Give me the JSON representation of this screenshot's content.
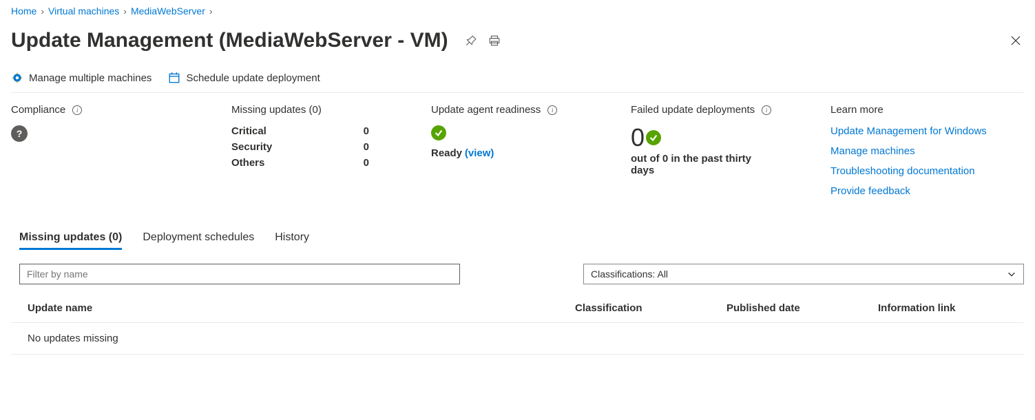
{
  "breadcrumb": {
    "items": [
      "Home",
      "Virtual machines",
      "MediaWebServer"
    ]
  },
  "page_title": "Update Management (MediaWebServer - VM)",
  "toolbar": {
    "manage_multiple": "Manage multiple machines",
    "schedule_deployment": "Schedule update deployment"
  },
  "stats": {
    "compliance_label": "Compliance",
    "missing_updates_label": "Missing updates (0)",
    "missing_rows": [
      {
        "label": "Critical",
        "value": "0"
      },
      {
        "label": "Security",
        "value": "0"
      },
      {
        "label": "Others",
        "value": "0"
      }
    ],
    "readiness_label": "Update agent readiness",
    "readiness_status": "Ready",
    "readiness_view": "(view)",
    "failed_label": "Failed update deployments",
    "failed_count": "0",
    "failed_sub": "out of 0 in the past thirty days",
    "learn_more_label": "Learn more",
    "learn_links": [
      "Update Management for Windows",
      "Manage machines",
      "Troubleshooting documentation",
      "Provide feedback"
    ]
  },
  "tabs": [
    {
      "label": "Missing updates (0)",
      "active": true
    },
    {
      "label": "Deployment schedules",
      "active": false
    },
    {
      "label": "History",
      "active": false
    }
  ],
  "filters": {
    "name_placeholder": "Filter by name",
    "classifications_text": "Classifications: All"
  },
  "table": {
    "columns": [
      "Update name",
      "Classification",
      "Published date",
      "Information link"
    ],
    "empty_text": "No updates missing"
  }
}
